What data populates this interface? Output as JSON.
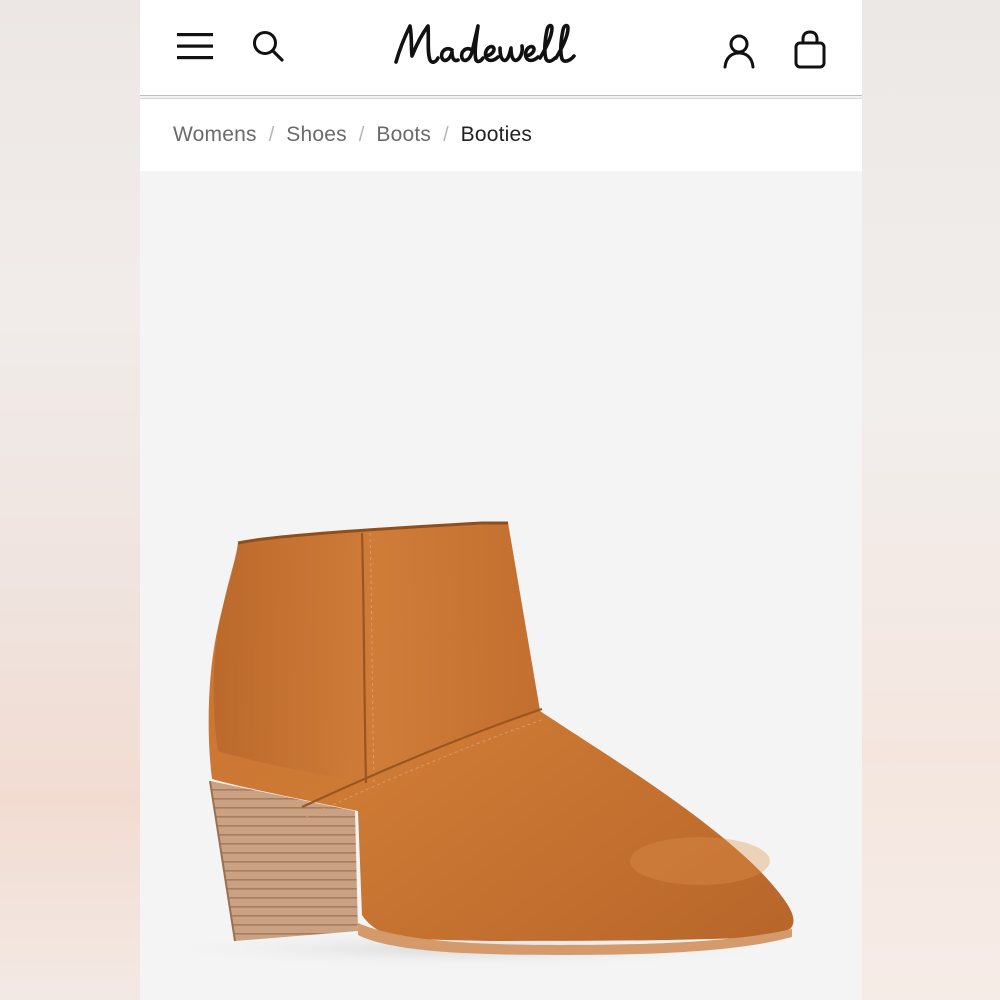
{
  "header": {
    "logo_text": "Madewell",
    "icons": [
      "menu-icon",
      "search-icon",
      "account-icon",
      "shopping-bag-icon"
    ]
  },
  "breadcrumb": {
    "items": [
      {
        "label": "Womens"
      },
      {
        "label": "Shoes"
      },
      {
        "label": "Boots"
      },
      {
        "label": "Booties"
      }
    ],
    "separator": "/"
  },
  "product": {
    "image_subject": "cognac leather ankle bootie with stacked heel"
  },
  "colors": {
    "leather": "#c9772f",
    "heel": "#c9a183",
    "background": "#f4f4f4",
    "text_dark": "#222222"
  }
}
